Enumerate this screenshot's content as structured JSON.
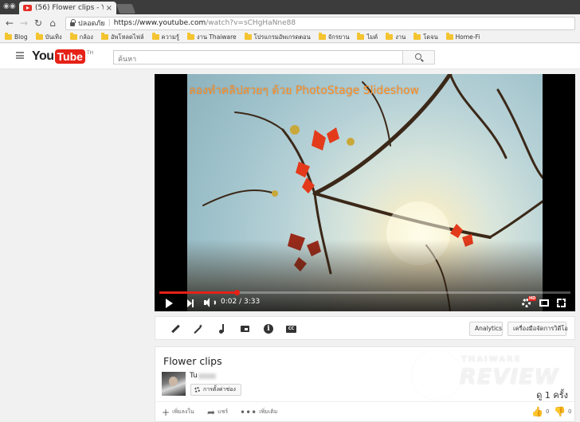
{
  "browser": {
    "tab_title": "(56) Flower clips - YouTu",
    "tab_close": "×",
    "secure_label": "ปลอดภัย",
    "url_main": "https://www.youtube.com",
    "url_rest": "/watch?v=sCHgHaNne88"
  },
  "bookmarks": [
    "Blog",
    "บันเทิง",
    "กล้อง",
    "อัพโหลดไฟล์",
    "ความรู้",
    "งาน Thaiware",
    "โปรแกรมอัพเกรดตอน",
    "จักรยาน",
    "ไมค์",
    "งาน",
    "โดจน",
    "Home-Fi"
  ],
  "youtube": {
    "logo_you": "You",
    "logo_tube": "Tube",
    "region": "TH",
    "search_placeholder": "ค้นหา"
  },
  "player": {
    "caption": "ลองทำคลิปสวยๆ ด้วย  PhotoStage Slideshow",
    "current_time": "0:02",
    "duration": "3:33",
    "progress": 0.19,
    "hd_badge": "HD"
  },
  "creator_bar": {
    "analytics_label": "Analytics",
    "video_manager_label": "เครื่องมือจัดการวิดีโอ"
  },
  "video": {
    "title": "Flower clips",
    "channel_name": "Tu",
    "channel_settings_label": "การตั้งค่าช่อง",
    "views": "ดู 1 ครั้ง",
    "add_label": "เพิ่มลงใน",
    "share_label": "แชร์",
    "more_label": "เพิ่มเติม",
    "likes": "0",
    "dislikes": "0"
  },
  "watermark": {
    "top": "THAIWARE",
    "main": "REVIEW"
  },
  "colors": {
    "youtube_red": "#e62117",
    "caption_orange": "#ff8a1c"
  }
}
